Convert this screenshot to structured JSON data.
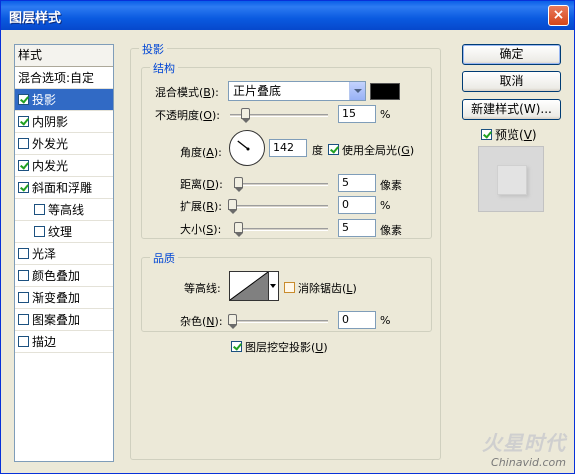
{
  "window": {
    "title": "图层样式",
    "close_label": "×"
  },
  "style_list": {
    "header": "样式",
    "items": [
      {
        "label": "混合选项:自定",
        "checkbox": false,
        "checked": false,
        "selected": false,
        "indent": false
      },
      {
        "label": "投影",
        "checkbox": true,
        "checked": true,
        "selected": true,
        "indent": false
      },
      {
        "label": "内阴影",
        "checkbox": true,
        "checked": true,
        "selected": false,
        "indent": false
      },
      {
        "label": "外发光",
        "checkbox": true,
        "checked": false,
        "selected": false,
        "indent": false
      },
      {
        "label": "内发光",
        "checkbox": true,
        "checked": true,
        "selected": false,
        "indent": false
      },
      {
        "label": "斜面和浮雕",
        "checkbox": true,
        "checked": true,
        "selected": false,
        "indent": false
      },
      {
        "label": "等高线",
        "checkbox": true,
        "checked": false,
        "selected": false,
        "indent": true
      },
      {
        "label": "纹理",
        "checkbox": true,
        "checked": false,
        "selected": false,
        "indent": true
      },
      {
        "label": "光泽",
        "checkbox": true,
        "checked": false,
        "selected": false,
        "indent": false
      },
      {
        "label": "颜色叠加",
        "checkbox": true,
        "checked": false,
        "selected": false,
        "indent": false
      },
      {
        "label": "渐变叠加",
        "checkbox": true,
        "checked": false,
        "selected": false,
        "indent": false
      },
      {
        "label": "图案叠加",
        "checkbox": true,
        "checked": false,
        "selected": false,
        "indent": false
      },
      {
        "label": "描边",
        "checkbox": true,
        "checked": false,
        "selected": false,
        "indent": false
      }
    ]
  },
  "drop_shadow": {
    "title": "投影",
    "structure": {
      "title": "结构",
      "blend_mode_label": "混合模式(",
      "blend_mode_key": "B",
      "blend_mode_value": "正片叠底",
      "shadow_color": "#000000",
      "opacity_label": "不透明度(",
      "opacity_key": "O",
      "opacity_value": "15",
      "opacity_fraction": 0.15,
      "angle_label": "角度(",
      "angle_key": "A",
      "angle_value": "142",
      "angle_deg": 142,
      "angle_unit": "度",
      "global_light_label": "使用全局光(",
      "global_light_key": "G",
      "global_light_checked": true,
      "distance_label": "距离(",
      "distance_key": "D",
      "distance_value": "5",
      "distance_unit": "像素",
      "spread_label": "扩展(",
      "spread_key": "R",
      "spread_value": "0",
      "size_label": "大小(",
      "size_key": "S",
      "size_value": "5",
      "size_unit": "像素",
      "percent": "%"
    },
    "quality": {
      "title": "品质",
      "contour_label": "等高线:",
      "anti_alias_label": "消除锯齿(",
      "anti_alias_key": "L",
      "noise_label": "杂色(",
      "noise_key": "N",
      "noise_value": "0",
      "percent": "%"
    },
    "knockout_label": "图层挖空投影(",
    "knockout_key": "U",
    "knockout_checked": true
  },
  "buttons": {
    "ok": "确定",
    "cancel": "取消",
    "new_style": "新建样式(W)...",
    "preview_label": "预览(",
    "preview_key": "V",
    "preview_checked": true
  },
  "close_paren": "):",
  "close_paren_plain": ")",
  "watermark": {
    "logo": "火星时代",
    "url": "Chinavid.com"
  }
}
